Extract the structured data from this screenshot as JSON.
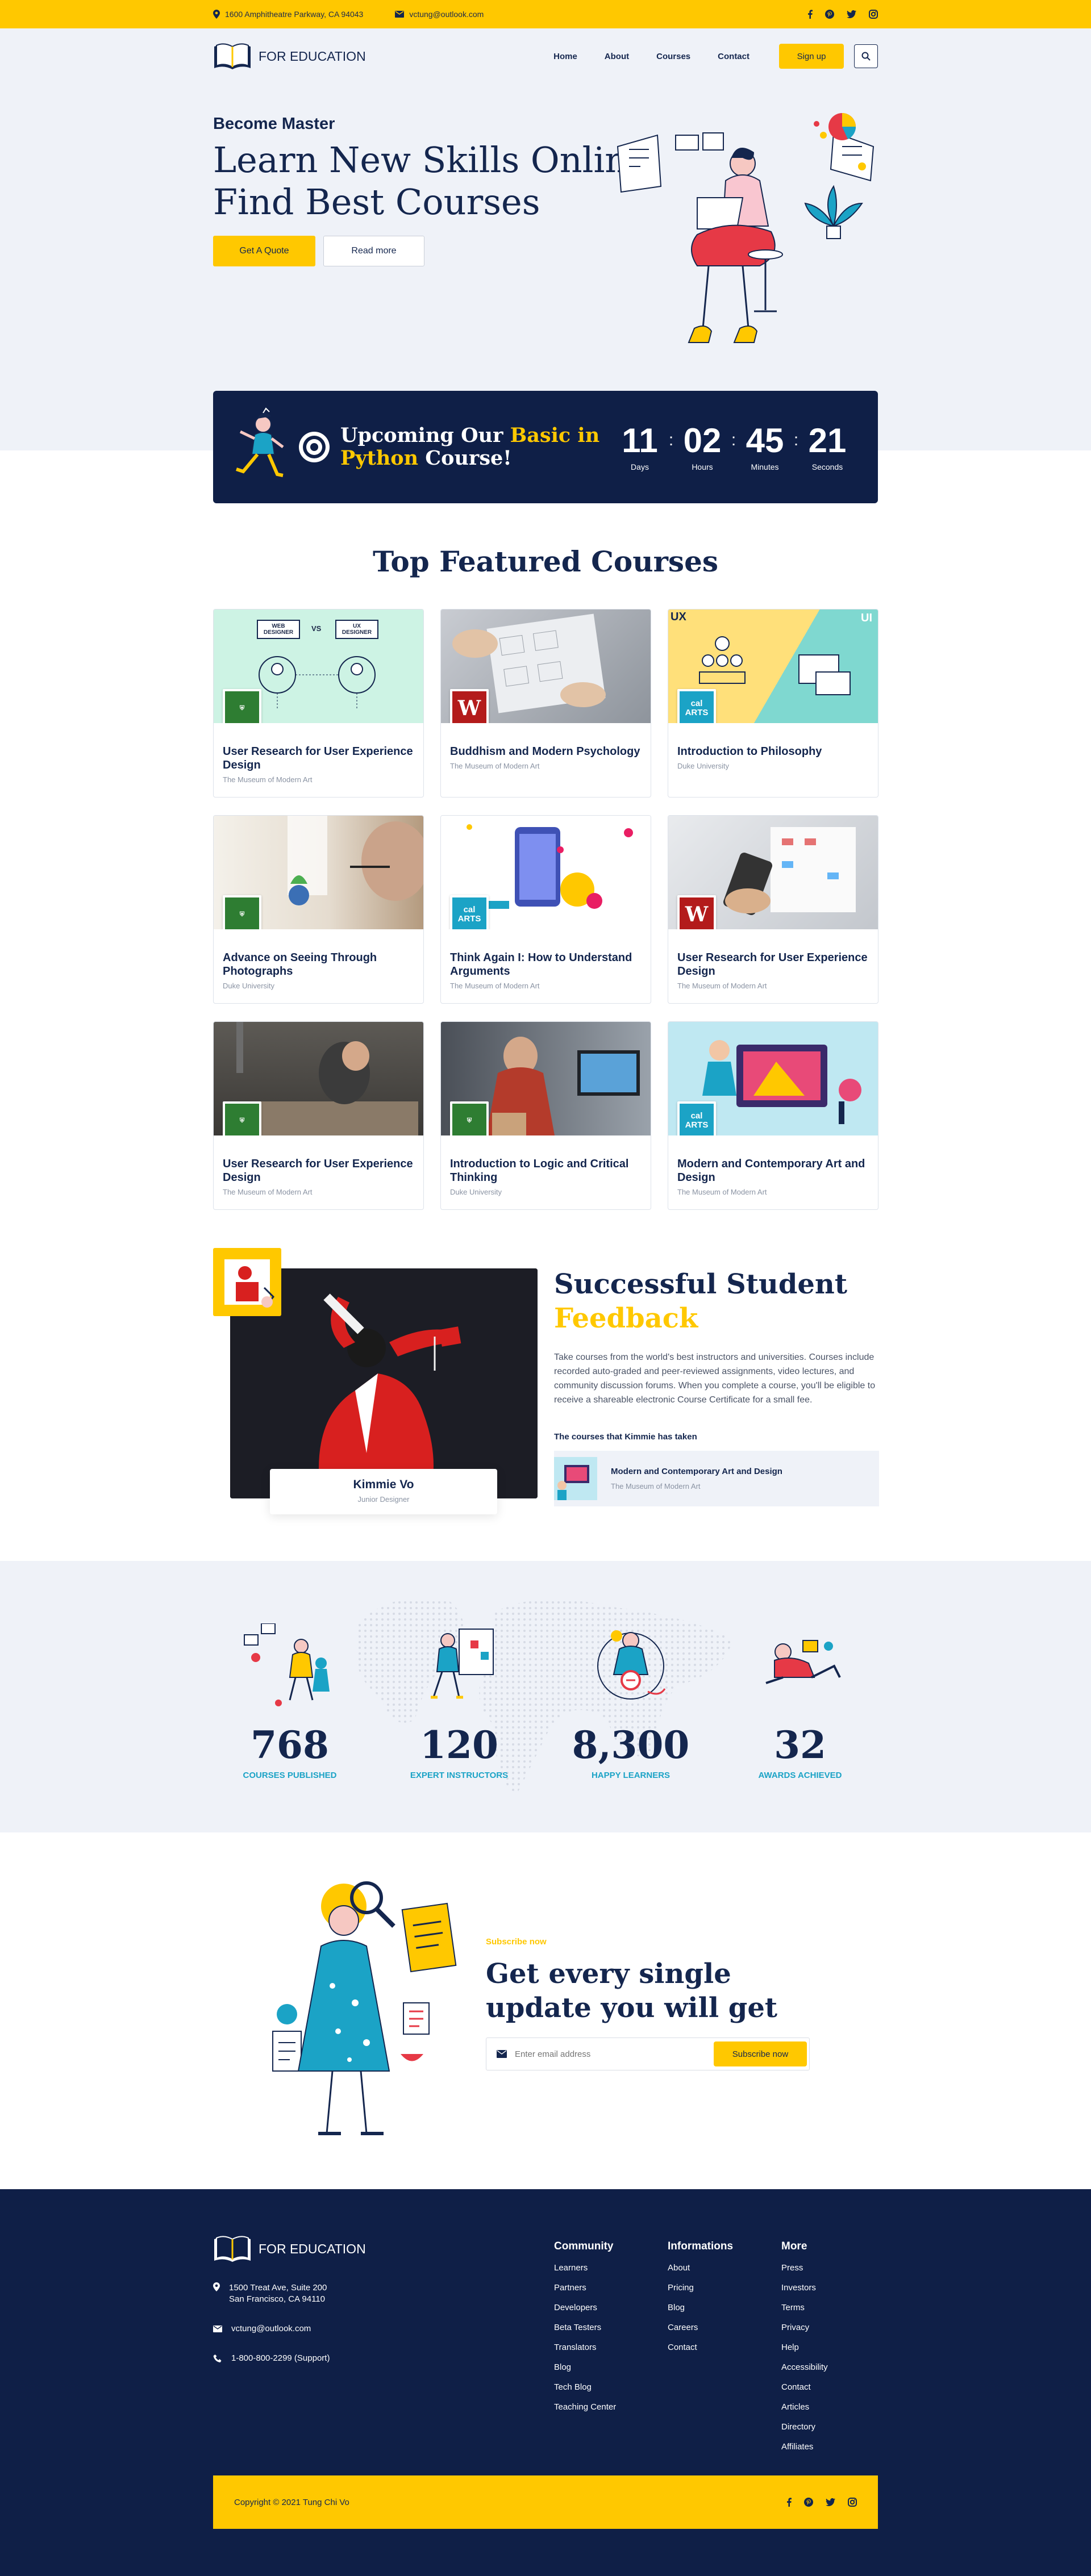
{
  "topbar": {
    "address": "1600 Amphitheatre Parkway, CA 94043",
    "email": "vctung@outlook.com",
    "social": [
      "facebook-icon",
      "pinterest-icon",
      "twitter-icon",
      "instagram-icon"
    ]
  },
  "brand": {
    "name": "FOR EDUCATION"
  },
  "nav": {
    "items": [
      "Home",
      "About",
      "Courses",
      "Contact"
    ],
    "signup": "Sign up"
  },
  "hero": {
    "eyebrow": "Become Master",
    "title_line1": "Learn New Skills Online",
    "title_line2": "Find Best Courses",
    "quote_btn": "Get A Quote",
    "read_btn": "Read more"
  },
  "countdown": {
    "prefix": "Upcoming Our ",
    "highlight1": "Basic in",
    "highlight2": "Python",
    "suffix": " Course!",
    "units": [
      {
        "value": "11",
        "label": "Days"
      },
      {
        "value": "02",
        "label": "Hours"
      },
      {
        "value": "45",
        "label": "Minutes"
      },
      {
        "value": "21",
        "label": "Seconds"
      }
    ]
  },
  "courses": {
    "title": "Top Featured Courses",
    "items": [
      {
        "title": "User Research for User Experience Design",
        "org": "The Museum of Modern Art"
      },
      {
        "title": "Buddhism and Modern Psychology",
        "org": "The Museum of Modern Art"
      },
      {
        "title": "Introduction to Philosophy",
        "org": "Duke University"
      },
      {
        "title": "Advance on Seeing Through Photographs",
        "org": "Duke University"
      },
      {
        "title": "Think Again I: How to Understand Arguments",
        "org": "The Museum of Modern Art"
      },
      {
        "title": "User Research for User Experience Design",
        "org": "The Museum of Modern Art"
      },
      {
        "title": "User Research for User Experience Design",
        "org": "The Museum of Modern Art"
      },
      {
        "title": "Introduction to Logic and Critical Thinking",
        "org": "Duke University"
      },
      {
        "title": "Modern and Contemporary Art and Design",
        "org": "The Museum of Modern Art"
      }
    ],
    "thumb_text": {
      "web": "WEB DESIGNER",
      "vs": "VS",
      "ux": "UX DESIGNER",
      "ux2": "UX",
      "ui": "UI",
      "cal": "cal",
      "arts": "ARTS",
      "w": "W"
    }
  },
  "feedback": {
    "title1": "Successful Student",
    "title2": "Feedback",
    "body": "Take courses from the world's best instructors and universities. Courses include recorded auto-graded and peer-reviewed assignments, video lectures, and community discussion forums. When you complete a course, you'll be eligible to receive a shareable electronic Course Certificate for a small fee.",
    "taken_label": "The courses that Kimmie has taken",
    "course_title": "Modern and Contemporary Art and Design",
    "course_org": "The Museum of Modern Art",
    "name": "Kimmie Vo",
    "role": "Junior Designer"
  },
  "stats": [
    {
      "value": "768",
      "label": "COURSES PUBLISHED"
    },
    {
      "value": "120",
      "label": "EXPERT INSTRUCTORS"
    },
    {
      "value": "8,300",
      "label": "HAPPY LEARNERS"
    },
    {
      "value": "32",
      "label": "AWARDS ACHIEVED"
    }
  ],
  "subscribe": {
    "tag": "Subscribe now",
    "title1": "Get every single",
    "title2": "update you will get",
    "placeholder": "Enter email address",
    "button": "Subscribe now"
  },
  "footer": {
    "address1": "1500 Treat Ave, Suite 200",
    "address2": "San Francisco, CA 94110",
    "email": "vctung@outlook.com",
    "phone": "1-800-800-2299 (Support)",
    "columns": [
      {
        "title": "Community",
        "links": [
          "Learners",
          "Partners",
          "Developers",
          "Beta Testers",
          "Translators",
          "Blog",
          "Tech Blog",
          "Teaching Center"
        ]
      },
      {
        "title": "Informations",
        "links": [
          "About",
          "Pricing",
          "Blog",
          "Careers",
          "Contact"
        ]
      },
      {
        "title": "More",
        "links": [
          "Press",
          "Investors",
          "Terms",
          "Privacy",
          "Help",
          "Accessibility",
          "Contact",
          "Articles",
          "Directory",
          "Affiliates"
        ]
      }
    ],
    "copyright": "Copyright © 2021 Tung Chi Vo"
  },
  "colors": {
    "accent": "#ffc800",
    "navy": "#0f1f47",
    "teal": "#1ba3c6",
    "bg": "#eff2f8"
  }
}
